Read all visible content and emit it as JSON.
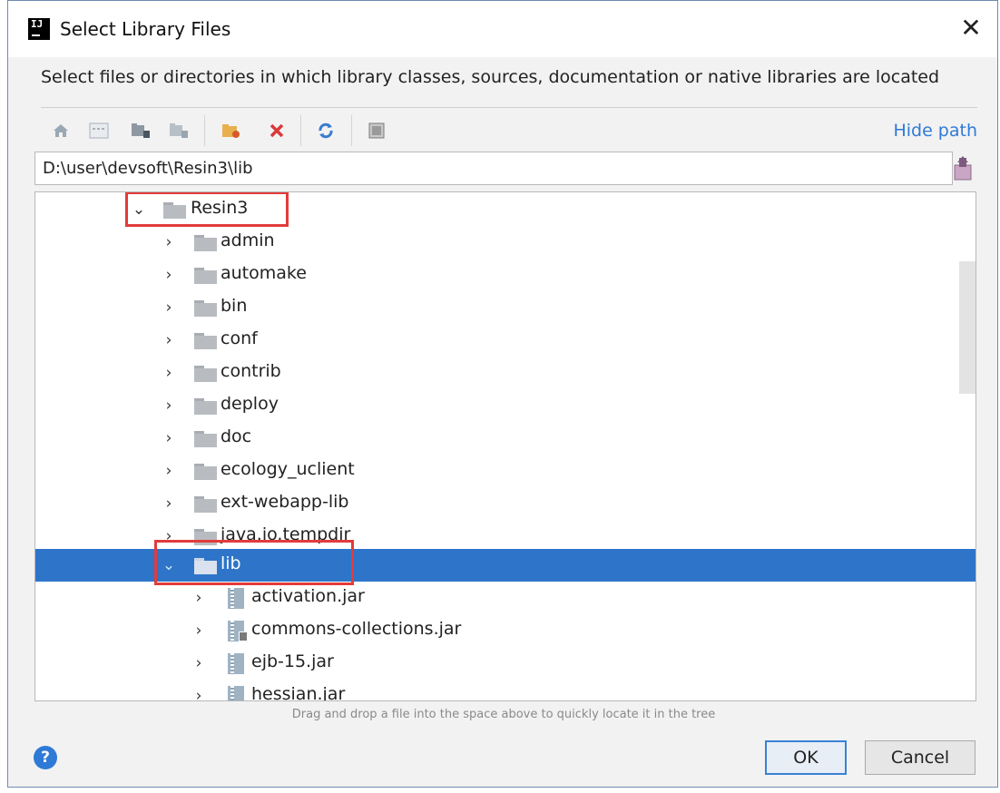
{
  "window": {
    "title": "Select Library Files",
    "app_icon_text": "IJ"
  },
  "description": "Select files or directories in which library classes, sources, documentation or native libraries are located",
  "toolbar": {
    "icons": [
      "home-icon",
      "desktop-icon",
      "project-icon",
      "module-icon",
      "new-folder-icon",
      "delete-icon",
      "refresh-icon",
      "show-hidden-icon"
    ],
    "hide_path_label": "Hide path"
  },
  "path": {
    "value": "D:\\user\\devsoft\\Resin3\\lib"
  },
  "tree": {
    "nodes": [
      {
        "label": "Resin3",
        "depth": 0,
        "type": "folder",
        "expanded": true,
        "selected": false
      },
      {
        "label": "admin",
        "depth": 1,
        "type": "folder",
        "expanded": false,
        "selected": false
      },
      {
        "label": "automake",
        "depth": 1,
        "type": "folder",
        "expanded": false,
        "selected": false
      },
      {
        "label": "bin",
        "depth": 1,
        "type": "folder",
        "expanded": false,
        "selected": false
      },
      {
        "label": "conf",
        "depth": 1,
        "type": "folder",
        "expanded": false,
        "selected": false
      },
      {
        "label": "contrib",
        "depth": 1,
        "type": "folder",
        "expanded": false,
        "selected": false
      },
      {
        "label": "deploy",
        "depth": 1,
        "type": "folder",
        "expanded": false,
        "selected": false
      },
      {
        "label": "doc",
        "depth": 1,
        "type": "folder",
        "expanded": false,
        "selected": false
      },
      {
        "label": "ecology_uclient",
        "depth": 1,
        "type": "folder",
        "expanded": false,
        "selected": false
      },
      {
        "label": "ext-webapp-lib",
        "depth": 1,
        "type": "folder",
        "expanded": false,
        "selected": false
      },
      {
        "label": "java.io.tempdir",
        "depth": 1,
        "type": "folder",
        "expanded": false,
        "selected": false
      },
      {
        "label": "lib",
        "depth": 1,
        "type": "folder",
        "expanded": true,
        "selected": true
      },
      {
        "label": "activation.jar",
        "depth": 2,
        "type": "jar",
        "expanded": false,
        "selected": false
      },
      {
        "label": "commons-collections.jar",
        "depth": 2,
        "type": "jar-locked",
        "expanded": false,
        "selected": false
      },
      {
        "label": "ejb-15.jar",
        "depth": 2,
        "type": "jar",
        "expanded": false,
        "selected": false
      },
      {
        "label": "hessian.jar",
        "depth": 2,
        "type": "jar",
        "expanded": false,
        "selected": false
      }
    ]
  },
  "hint": "Drag and drop a file into the space above to quickly locate it in the tree",
  "footer": {
    "help_symbol": "?",
    "ok_label": "OK",
    "cancel_label": "Cancel"
  },
  "colors": {
    "selection": "#2e75c9",
    "link": "#2f7ad6",
    "annotation_box": "#e23b3b"
  }
}
